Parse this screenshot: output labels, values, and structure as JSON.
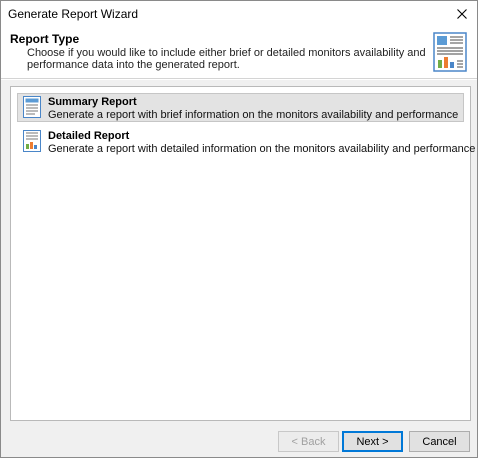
{
  "window": {
    "title": "Generate Report Wizard"
  },
  "header": {
    "title": "Report Type",
    "description": "Choose if you would like to include either brief or detailed monitors availability and performance data into the generated report.",
    "icon": "report-document-icon"
  },
  "options": [
    {
      "name": "Summary Report",
      "description": "Generate a report with brief information on the monitors availability and performance",
      "icon": "summary-report-icon",
      "selected": true
    },
    {
      "name": "Detailed Report",
      "description": "Generate a report with detailed information on the monitors availability and performance",
      "icon": "detailed-report-icon",
      "selected": false
    }
  ],
  "buttons": {
    "back": "< Back",
    "next": "Next >",
    "cancel": "Cancel"
  },
  "colors": {
    "selection": "#e3e3e3",
    "default_button_border": "#0078d7",
    "panel_background": "#f0f0f0"
  }
}
